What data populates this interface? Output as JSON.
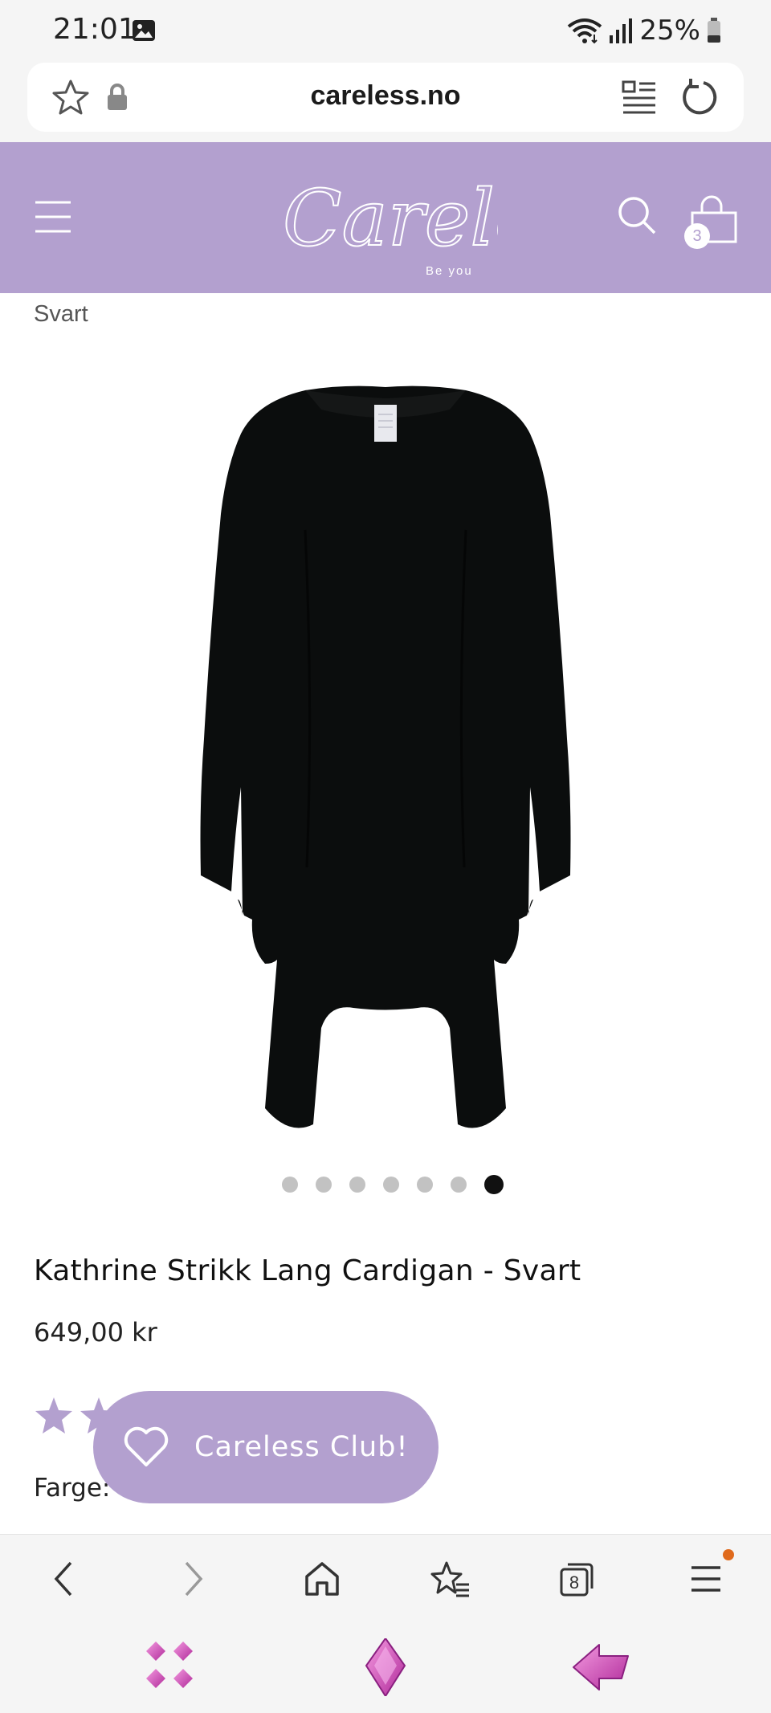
{
  "status_bar": {
    "time": "21:01",
    "battery": "25%",
    "icons": [
      "image-icon",
      "wifi-icon",
      "signal-icon",
      "battery-icon"
    ]
  },
  "url_bar": {
    "url": "careless.no",
    "icons": [
      "star-icon",
      "lock-icon",
      "reader-mode-icon",
      "reload-icon"
    ]
  },
  "header": {
    "logo_text": "Careless",
    "logo_tagline": "Be you",
    "cart_count": "3",
    "brand_color": "#b3a0cf",
    "icons": [
      "menu-icon",
      "search-icon",
      "shopping-bag-icon"
    ]
  },
  "product": {
    "variant": "Svart",
    "title": "Kathrine Strikk Lang Cardigan - Svart",
    "price": "649,00 kr",
    "color_label": "Farge:",
    "image_count": 7,
    "active_image": 7,
    "rating_star_color": "#b3a0cf"
  },
  "club_button": {
    "label": "Careless Club!",
    "icon": "heart-icon"
  },
  "browser_toolbar": {
    "tabs_count": "8",
    "icons": [
      "back-icon",
      "forward-icon",
      "home-icon",
      "bookmarks-icon",
      "tabs-icon",
      "menu-icon"
    ],
    "notification_color": "#e06a1c"
  },
  "nav_bar": {
    "icons": [
      "recent-apps-icon",
      "home-diamond-icon",
      "back-arrow-icon"
    ]
  }
}
